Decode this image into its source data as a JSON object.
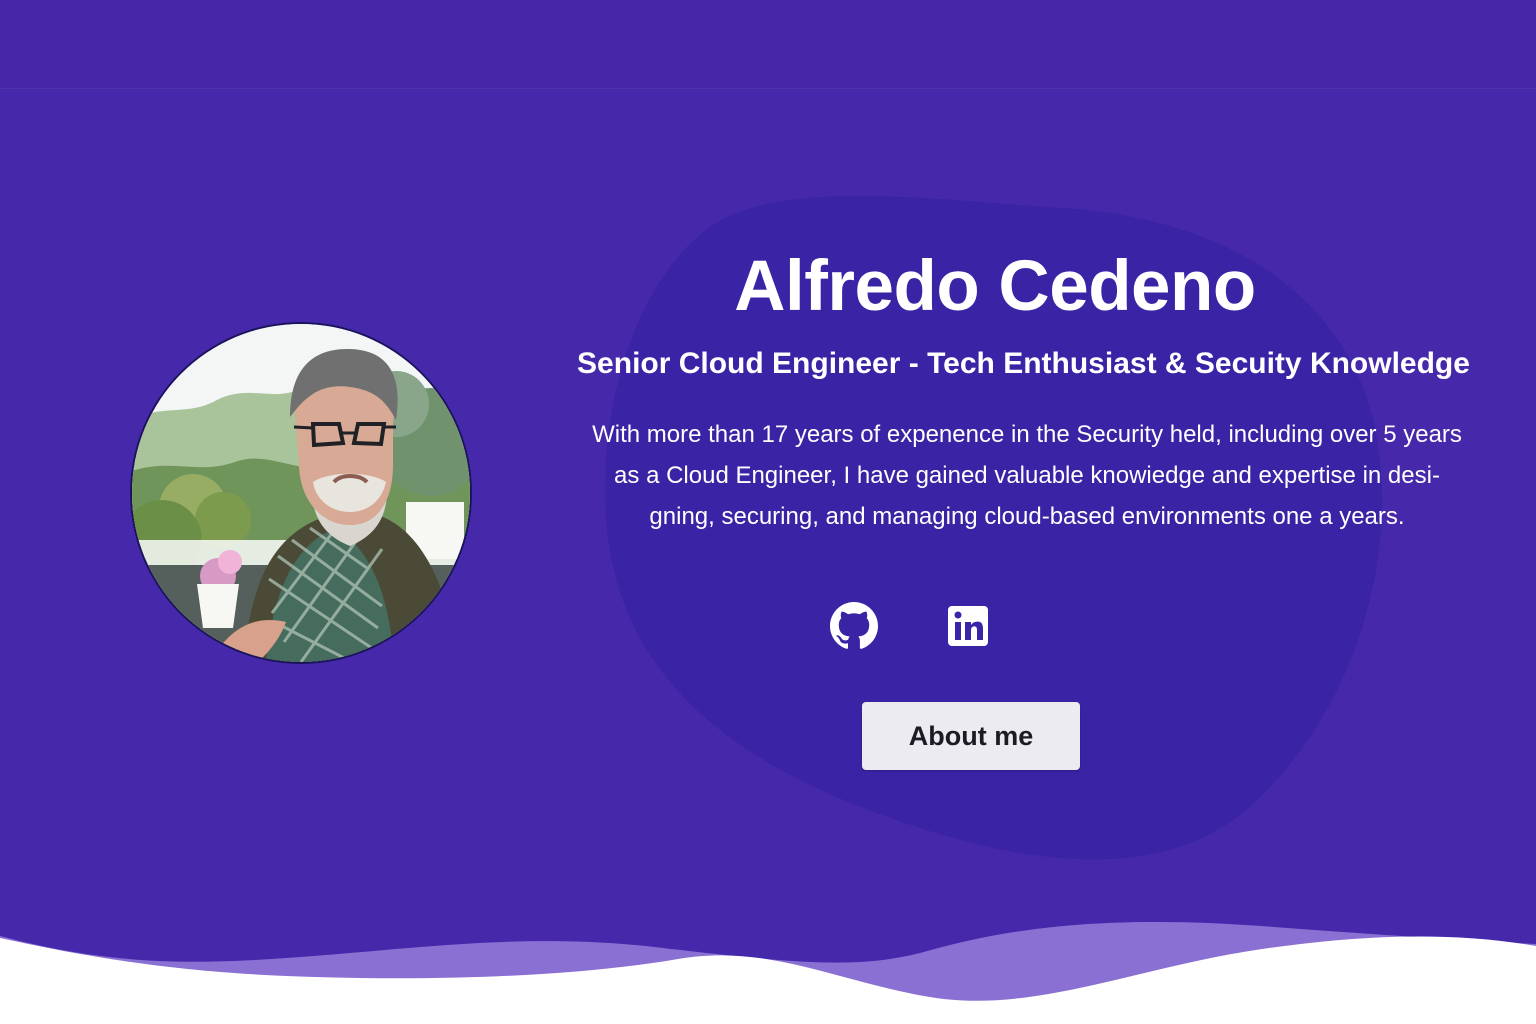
{
  "profile": {
    "name": "Alfredo Cedeno",
    "subtitle": "Senior Cloud Engineer - Tech Enthusiast & Secuity Knowledge",
    "bio_lines": [
      "With more than 17 years of expenence in the Security held, including over 5 years",
      "as a Cloud Engineer, I have gained valuable knowiedge and expertise in desi-",
      "gning, securing, and managing cloud-based environments one a years."
    ]
  },
  "social": {
    "github_icon": "github-icon",
    "linkedin_icon": "linkedin-icon"
  },
  "actions": {
    "about_label": "About me"
  },
  "colors": {
    "hero_background": "#4629ab",
    "blob": "#3a23a5",
    "wave_light": "#8b70d4",
    "button_background": "#ececf0",
    "text": "#ffffff"
  }
}
